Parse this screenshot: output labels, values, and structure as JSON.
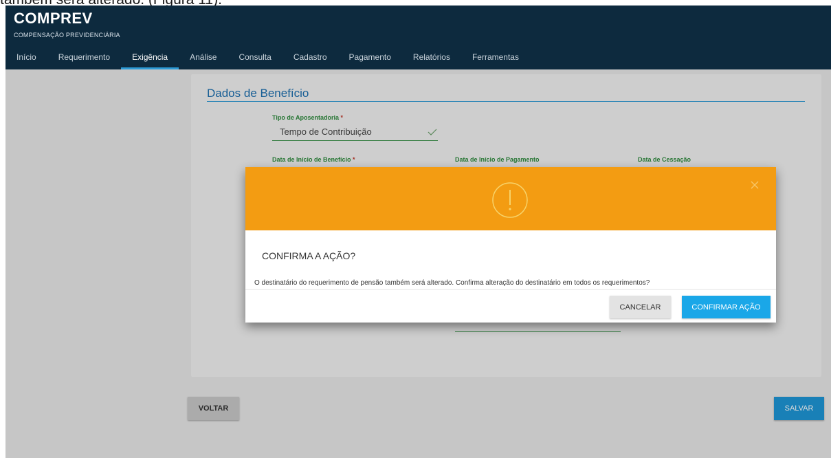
{
  "caption": "também será alterado. (Figura 11).",
  "app": {
    "brand": "COMPREV",
    "brand_sub": "COMPENSAÇÃO PREVIDENCIÁRIA",
    "nav": [
      "Início",
      "Requerimento",
      "Exigência",
      "Análise",
      "Consulta",
      "Cadastro",
      "Pagamento",
      "Relatórios",
      "Ferramentas"
    ],
    "active_nav": "Exigência"
  },
  "form": {
    "section_title": "Dados de Benefício",
    "tipo_label": "Tipo de Aposentadoria",
    "tipo_value": "Tempo de Contribuição",
    "inicio_beneficio_label": "Data de Início de Benefício",
    "inicio_pagamento_label": "Data de Início de Pagamento",
    "cessacao_label": "Data de Cessação",
    "required_mark": "*"
  },
  "buttons": {
    "voltar": "VOLTAR",
    "salvar": "SALVAR"
  },
  "modal": {
    "title": "CONFIRMA A AÇÃO?",
    "message": "O destinatário do requerimento de pensão também será alterado. Confirma alteração do destinatário em todos os requerimentos?",
    "cancel_label": "CANCELAR",
    "confirm_label": "CONFIRMAR AÇÃO",
    "header_color": "#f39c12",
    "confirm_color": "#1aa7e8"
  },
  "colors": {
    "topbar": "#0d2a3e",
    "accent": "#2d9bd6",
    "field_green": "#2e8b3e"
  }
}
